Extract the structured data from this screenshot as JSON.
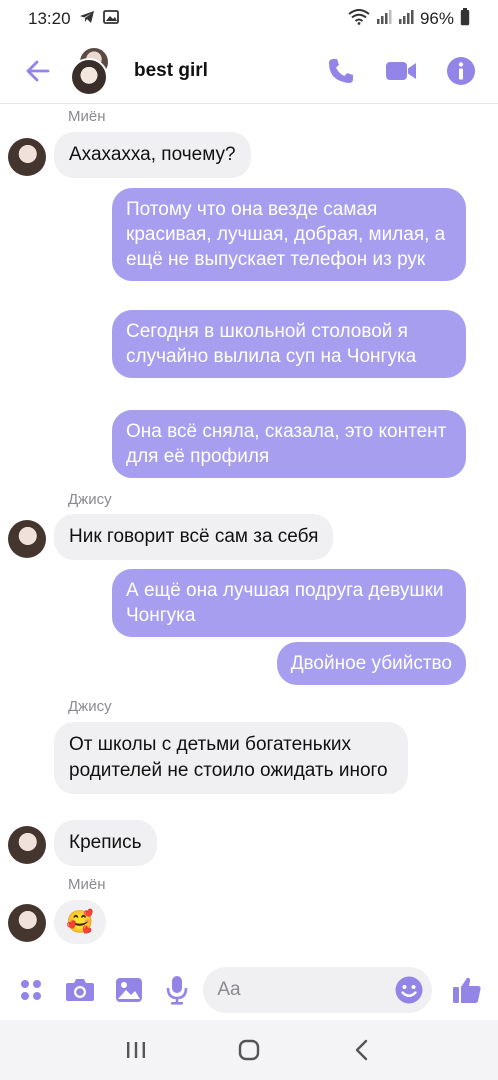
{
  "status_bar": {
    "time": "13:20",
    "battery": "96%"
  },
  "header": {
    "title": "best girl"
  },
  "colors": {
    "accent": "#9385e8",
    "bubble_out": "#a89ef0",
    "bubble_in": "#f0f0f2"
  },
  "icons": {
    "back": "arrow-left-icon",
    "call": "phone-icon",
    "video": "video-camera-icon",
    "info": "info-icon",
    "apps": "apps-grid-icon",
    "camera": "camera-icon",
    "gallery": "image-icon",
    "mic": "microphone-icon",
    "emoji": "smiley-icon",
    "like": "thumbs-up-icon"
  },
  "messages": [
    {
      "sender": "Миён",
      "text": "Ахахахха, почему?"
    },
    {
      "out": "Потому что она везде самая красивая, лучшая, добрая, милая, а ещё не выпускает телефон из рук"
    },
    {
      "out": "Сегодня в школьной столовой я случайно вылила суп на Чонгука"
    },
    {
      "out": "Она всё сняла, сказала, это контент для её профиля"
    },
    {
      "sender": "Джису",
      "text": "Ник говорит всё сам за себя"
    },
    {
      "out": "А ещё она лучшая подруга девушки Чонгука"
    },
    {
      "out": "Двойное убийство"
    },
    {
      "sender": "Джису",
      "text": "От школы с детьми богатеньких родителей не стоило ожидать иного"
    },
    {
      "text": "Крепись"
    },
    {
      "sender": "Миён",
      "emoji": "🥰"
    }
  ],
  "composer": {
    "placeholder": "Aa"
  }
}
